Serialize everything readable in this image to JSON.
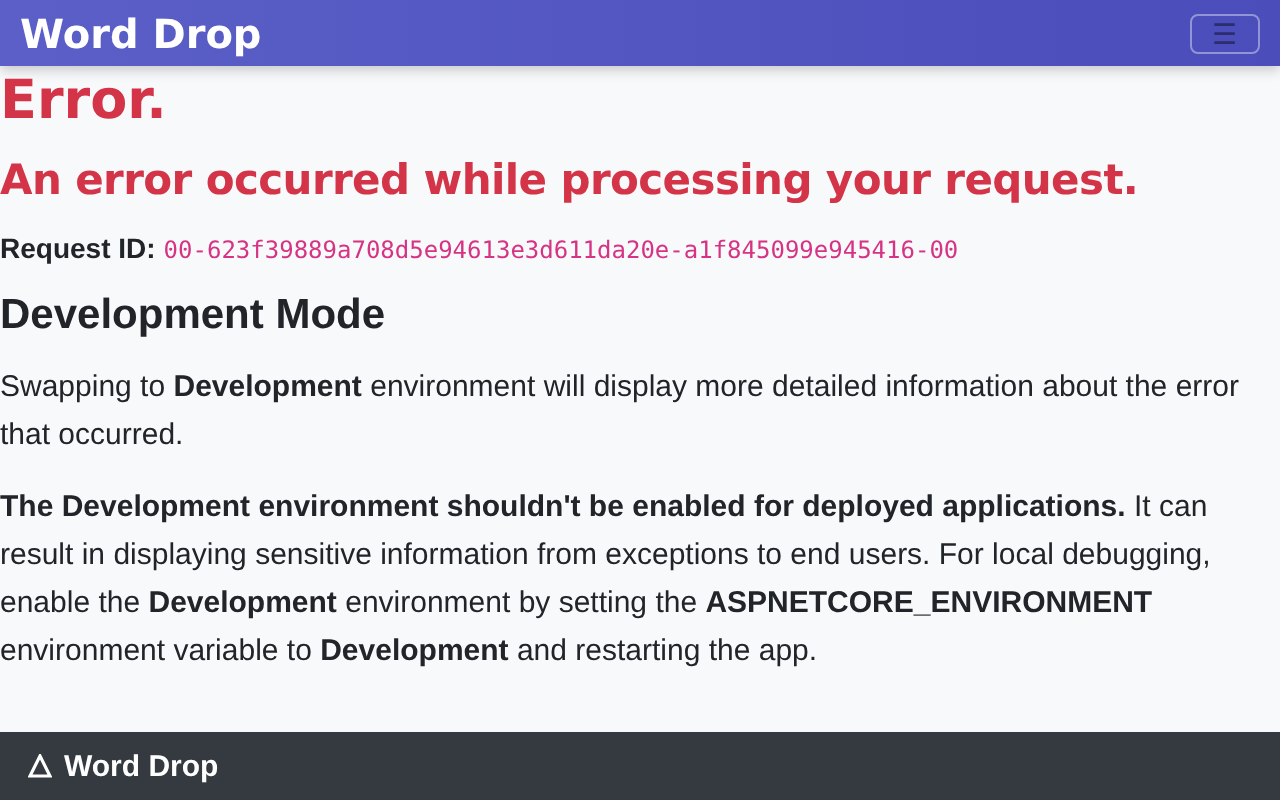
{
  "navbar": {
    "brand": "Word Drop",
    "menu_toggle": "☰"
  },
  "error": {
    "title": "Error.",
    "message": "An error occurred while processing your request.",
    "request_id_label": "Request ID:",
    "request_id": "00-623f39889a708d5e94613e3d611da20e-a1f845099e945416-00"
  },
  "development": {
    "heading": "Development Mode",
    "paragraphs": [
      "Swapping to **Development** environment will display more detailed information about the error that occurred.",
      "**The Development environment shouldn't be enabled for deployed applications.** It can result in displaying sensitive information from exceptions to end users. For local debugging, enable the **Development** environment by setting the **ASPNETCORE_ENVIRONMENT** environment variable to **Development** and restarting the app."
    ]
  },
  "footer": {
    "brand": "Word Drop"
  }
}
